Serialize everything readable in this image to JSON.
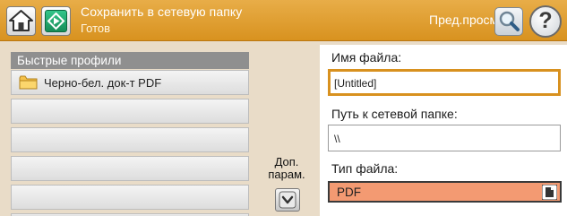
{
  "header": {
    "title": "Сохранить в сетевую папку",
    "status": "Готов",
    "preview_label": "Пред.просм.",
    "help_label": "?"
  },
  "quick_sets": {
    "title": "Быстрые профили",
    "items": [
      {
        "label": "Черно-бел. док-т PDF",
        "icon": "folder-icon"
      },
      {
        "label": ""
      },
      {
        "label": ""
      },
      {
        "label": ""
      },
      {
        "label": ""
      },
      {
        "label": ""
      }
    ]
  },
  "more_options": {
    "label_line1": "Доп.",
    "label_line2": "парам."
  },
  "form": {
    "file_name_label": "Имя файла:",
    "file_name_value": "[Untitled]",
    "network_path_label": "Путь к сетевой папке:",
    "network_path_value": "\\\\",
    "file_type_label": "Тип файла:",
    "file_type_value": "PDF"
  },
  "colors": {
    "header": "#d8921f",
    "file_type_select": "#f39a72",
    "focus_border": "#d8911f"
  }
}
